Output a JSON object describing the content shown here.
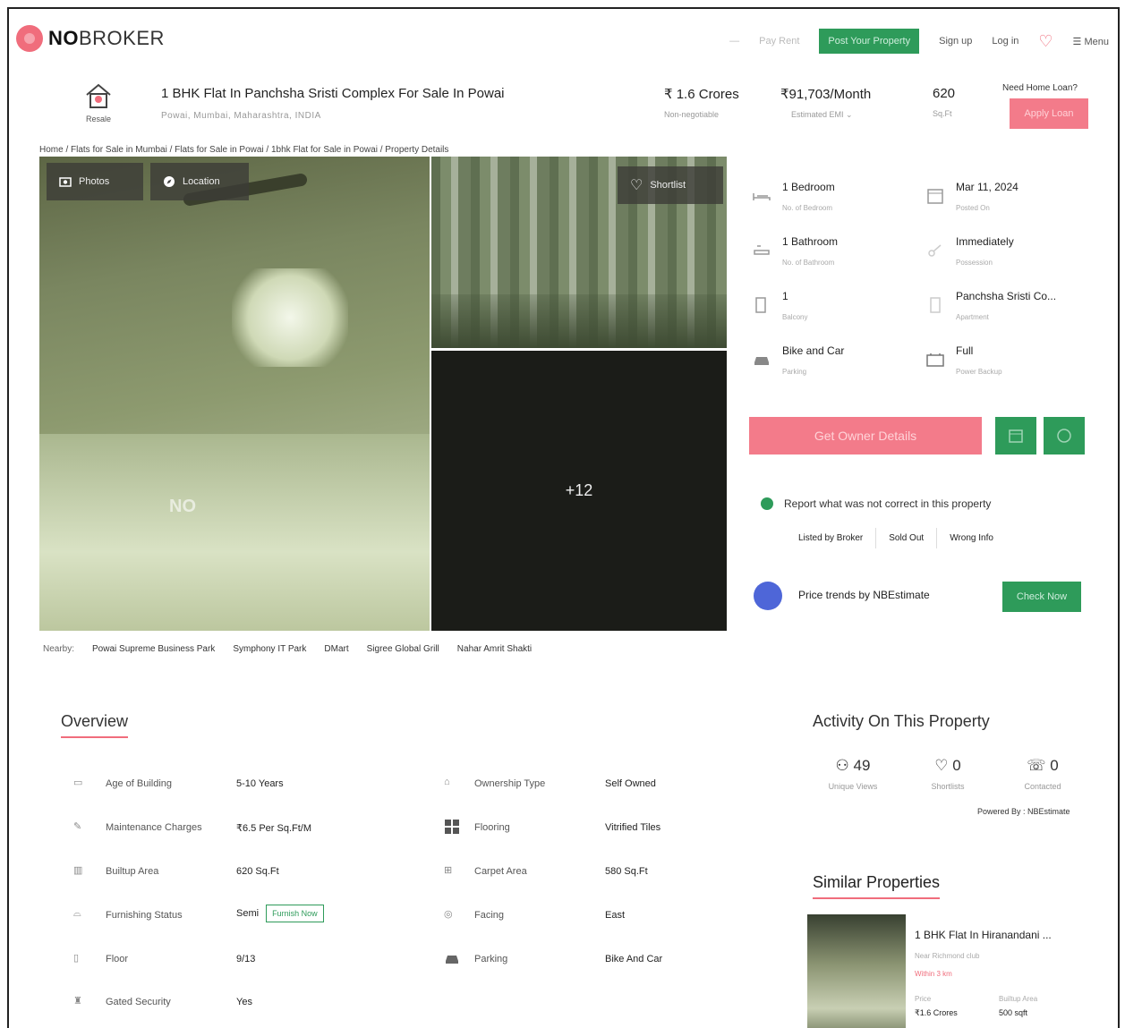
{
  "header": {
    "brand_a": "NO",
    "brand_b": "BROKER",
    "nav_dash": "—",
    "pay_rent": "Pay Rent",
    "post_property": "Post Your Property",
    "sign_up": "Sign up",
    "log_in": "Log in",
    "menu": "Menu"
  },
  "listing": {
    "badge": "Resale",
    "title": "1 BHK Flat In Panchsha Sristi Complex For Sale In Powai",
    "address": "Powai, Mumbai, Maharashtra, INDIA",
    "price": "₹ 1.6 Crores",
    "price_note": "Non-negotiable",
    "emi": "₹91,703/Month",
    "emi_note": "Estimated EMI",
    "area": "620",
    "area_unit": "Sq.Ft",
    "loan_question": "Need Home Loan?",
    "apply_loan": "Apply Loan"
  },
  "breadcrumb": "Home / Flats for Sale in Mumbai / Flats for Sale in Powai / 1bhk Flat for Sale in Powai / Property Details",
  "gallery": {
    "photos_label": "Photos",
    "location_label": "Location",
    "shortlist_label": "Shortlist",
    "more_count": "+12",
    "watermark": "NO"
  },
  "nearby": {
    "label": "Nearby:",
    "places": [
      "Powai Supreme Business Park",
      "Symphony IT Park",
      "DMart",
      "Sigree Global Grill",
      "Nahar Amrit Shakti"
    ]
  },
  "facts": [
    {
      "value": "1 Bedroom",
      "label": "No. of Bedroom",
      "icon": "bed-icon"
    },
    {
      "value": "Mar 11, 2024",
      "label": "Posted On",
      "icon": "calendar-icon"
    },
    {
      "value": "1 Bathroom",
      "label": "No. of Bathroom",
      "icon": "bath-icon"
    },
    {
      "value": "Immediately",
      "label": "Possession",
      "icon": "key-icon"
    },
    {
      "value": "1",
      "label": "Balcony",
      "icon": "balcony-icon"
    },
    {
      "value": "Panchsha Sristi Co...",
      "label": "Apartment",
      "icon": "building-icon"
    },
    {
      "value": "Bike and Car",
      "label": "Parking",
      "icon": "car-icon"
    },
    {
      "value": "Full",
      "label": "Power Backup",
      "icon": "power-icon"
    }
  ],
  "actions": {
    "owner_details": "Get Owner Details",
    "report_text": "Report what was not correct in this property",
    "report_chips": [
      "Listed by Broker",
      "Sold Out",
      "Wrong Info"
    ],
    "price_trends": "Price trends by NBEstimate",
    "check_now": "Check Now"
  },
  "overview": {
    "title": "Overview",
    "rows": [
      {
        "label": "Age of Building",
        "value": "5-10 Years",
        "icon": "age-icon"
      },
      {
        "label": "Ownership Type",
        "value": "Self Owned",
        "icon": "ownership-icon"
      },
      {
        "label": "Maintenance Charges",
        "value": "₹6.5 Per Sq.Ft/M",
        "icon": "maintenance-icon"
      },
      {
        "label": "Flooring",
        "value": "Vitrified Tiles",
        "icon": "flooring-icon"
      },
      {
        "label": "Builtup Area",
        "value": "620 Sq.Ft",
        "icon": "builtup-icon"
      },
      {
        "label": "Carpet Area",
        "value": "580 Sq.Ft",
        "icon": "carpet-icon"
      },
      {
        "label": "Furnishing Status",
        "value": "Semi",
        "icon": "furnishing-icon"
      },
      {
        "label": "Facing",
        "value": "East",
        "icon": "compass-icon"
      },
      {
        "label": "Floor",
        "value": "9/13",
        "icon": "floor-icon"
      },
      {
        "label": "Parking",
        "value": "Bike And Car",
        "icon": "car-icon"
      },
      {
        "label": "Gated Security",
        "value": "Yes",
        "icon": "security-icon"
      }
    ],
    "furnish_now": "Furnish Now"
  },
  "activity": {
    "title": "Activity On This Property",
    "views": "49",
    "views_label": "Unique Views",
    "shortlists": "0",
    "shortlists_label": "Shortlists",
    "contacted": "0",
    "contacted_label": "Contacted",
    "powered_by": "Powered By : NBEstimate"
  },
  "similar": {
    "title": "Similar Properties",
    "name": "1 BHK Flat In Hiranandani ...",
    "subtitle": "Near Richmond club",
    "distance": "Within 3 km",
    "price_label": "Price",
    "price": "₹1.6 Crores",
    "area_label": "Builtup Area",
    "area": "500 sqft"
  },
  "colors": {
    "brand_pink": "#f06d7c",
    "brand_green": "#2e9b5a",
    "trend_blue": "#4e66d8"
  }
}
